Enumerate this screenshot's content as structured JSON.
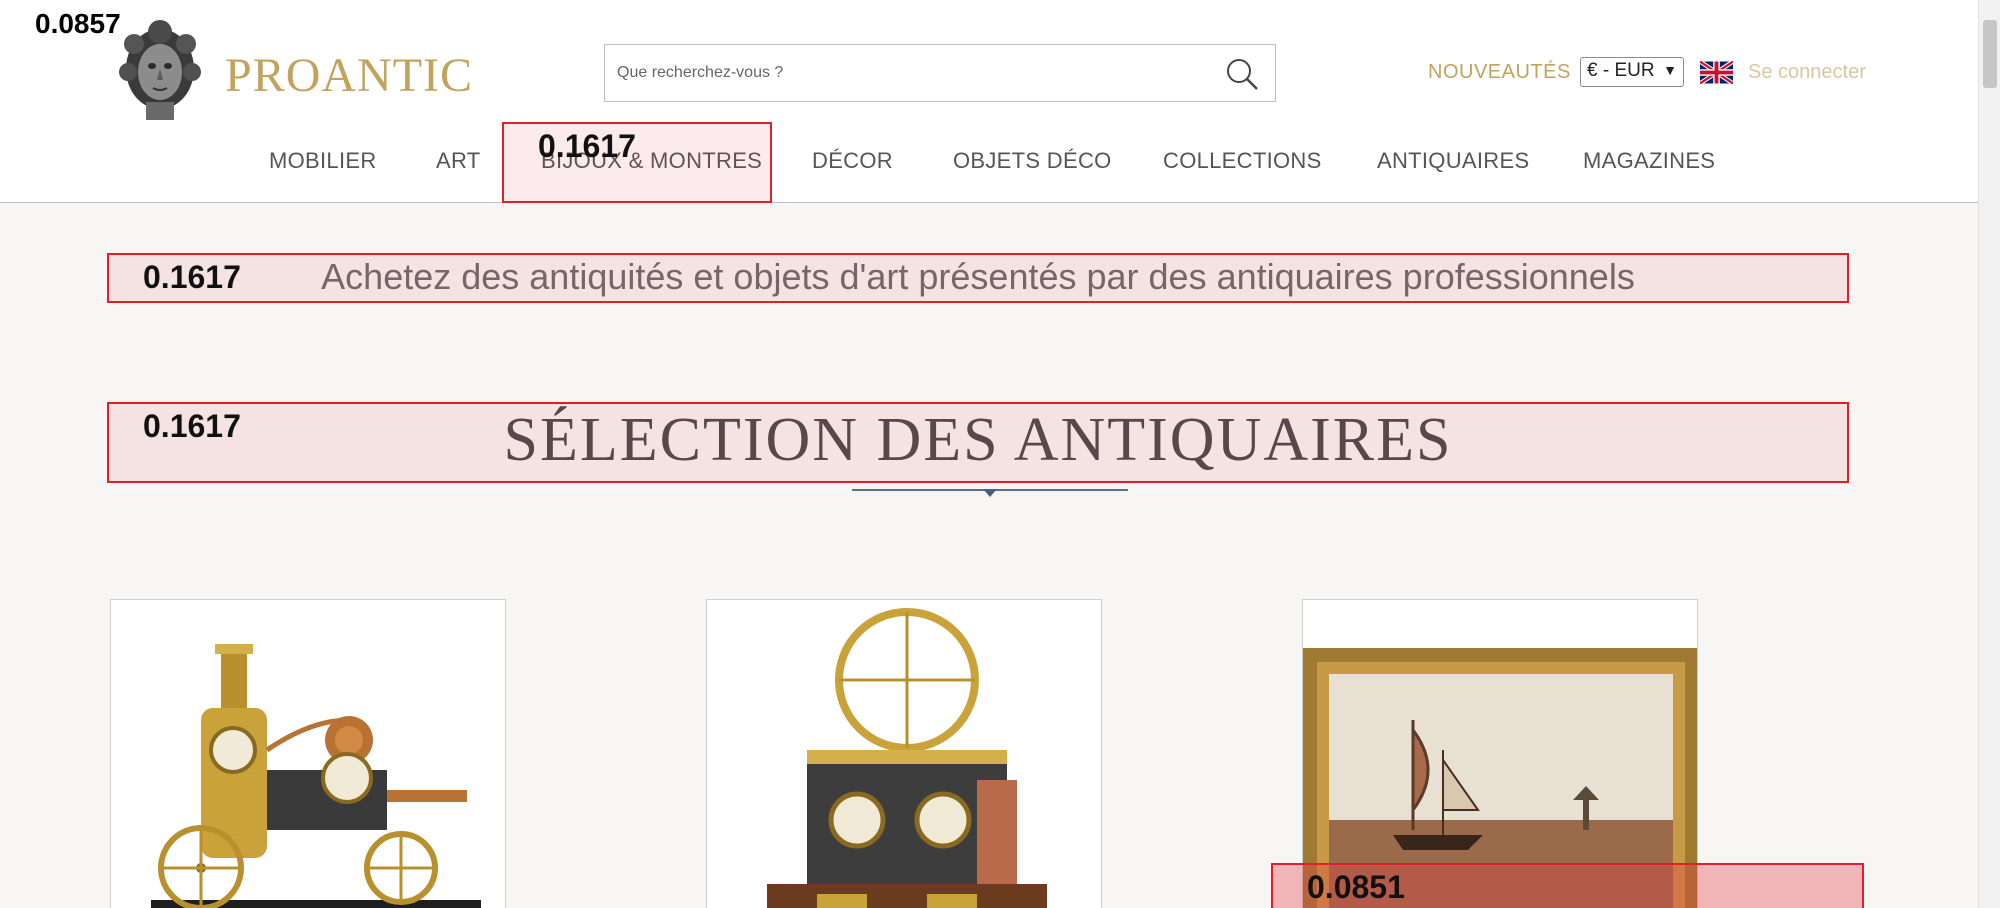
{
  "header": {
    "logo_text": "PROANTIC",
    "search_placeholder": "Que recherchez-vous ?",
    "nouveautes": "NOUVEAUTÉS",
    "currency": "€ - EUR",
    "login": "Se connecter",
    "brand_color": "#c1a35e"
  },
  "nav": {
    "items": [
      {
        "label": "MOBILIER"
      },
      {
        "label": "ART"
      },
      {
        "label": "BIJOUX & MONTRES"
      },
      {
        "label": "DÉCOR"
      },
      {
        "label": "OBJETS DÉCO"
      },
      {
        "label": "COLLECTIONS"
      },
      {
        "label": "ANTIQUAIRES"
      },
      {
        "label": "MAGAZINES"
      }
    ]
  },
  "main": {
    "tagline": "Achetez des antiquités et objets d'art présentés par des antiquaires professionnels",
    "section_title": "SÉLECTION DES ANTIQUAIRES",
    "products": [
      {
        "image": "steam-fire-engine-clock"
      },
      {
        "image": "steam-engine-clock"
      },
      {
        "image": "seascape-painting"
      }
    ]
  },
  "overlays": {
    "corner_label": "0.0857",
    "nav_box_label": "0.1617",
    "tagline_box_label": "0.1617",
    "title_box_label": "0.1617",
    "card_box_label": "0.0851"
  }
}
